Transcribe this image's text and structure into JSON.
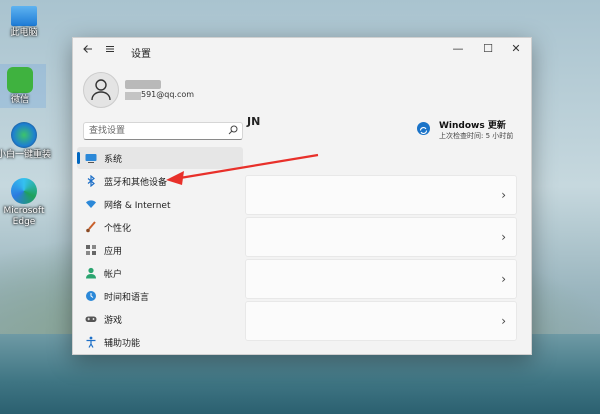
{
  "desktop": {
    "icons": [
      {
        "label": "此电脑",
        "icon": "computer-icon"
      },
      {
        "label": "微信",
        "icon": "wechat-icon"
      },
      {
        "label": "小白一键重装",
        "icon": "installer-icon"
      },
      {
        "label": "Microsoft Edge",
        "icon": "edge-icon"
      }
    ]
  },
  "window": {
    "title": "设置",
    "back_icon": "back-arrow-icon",
    "menu_icon": "hamburger-icon",
    "controls": {
      "minimize": "—",
      "maximize": "☐",
      "close": "✕"
    }
  },
  "profile": {
    "email_suffix": "591@qq.com"
  },
  "search": {
    "placeholder": "查找设置"
  },
  "nav": {
    "items": [
      {
        "label": "系统",
        "icon": "monitor-icon",
        "color": "#2b88d8"
      },
      {
        "label": "蓝牙和其他设备",
        "icon": "bluetooth-icon",
        "color": "#1d6fc7"
      },
      {
        "label": "网络 & Internet",
        "icon": "wifi-icon",
        "color": "#2b88d8"
      },
      {
        "label": "个性化",
        "icon": "brush-icon",
        "color": "#c9602b"
      },
      {
        "label": "应用",
        "icon": "apps-icon",
        "color": "#666666"
      },
      {
        "label": "帐户",
        "icon": "account-icon",
        "color": "#2aa46f"
      },
      {
        "label": "时间和语言",
        "icon": "clock-globe-icon",
        "color": "#2b88d8"
      },
      {
        "label": "游戏",
        "icon": "gamepad-icon",
        "color": "#555555"
      },
      {
        "label": "辅助功能",
        "icon": "accessibility-icon",
        "color": "#1d6fc7"
      }
    ]
  },
  "content": {
    "title_fragment": "JN",
    "update": {
      "title": "Windows 更新",
      "subtitle": "上次检查时间: 5 小时前"
    },
    "cards": [
      {
        "chevron": "›"
      },
      {
        "chevron": "›"
      },
      {
        "chevron": "›"
      },
      {
        "chevron": "›"
      }
    ]
  },
  "annotation": {
    "color": "#e8302a"
  }
}
